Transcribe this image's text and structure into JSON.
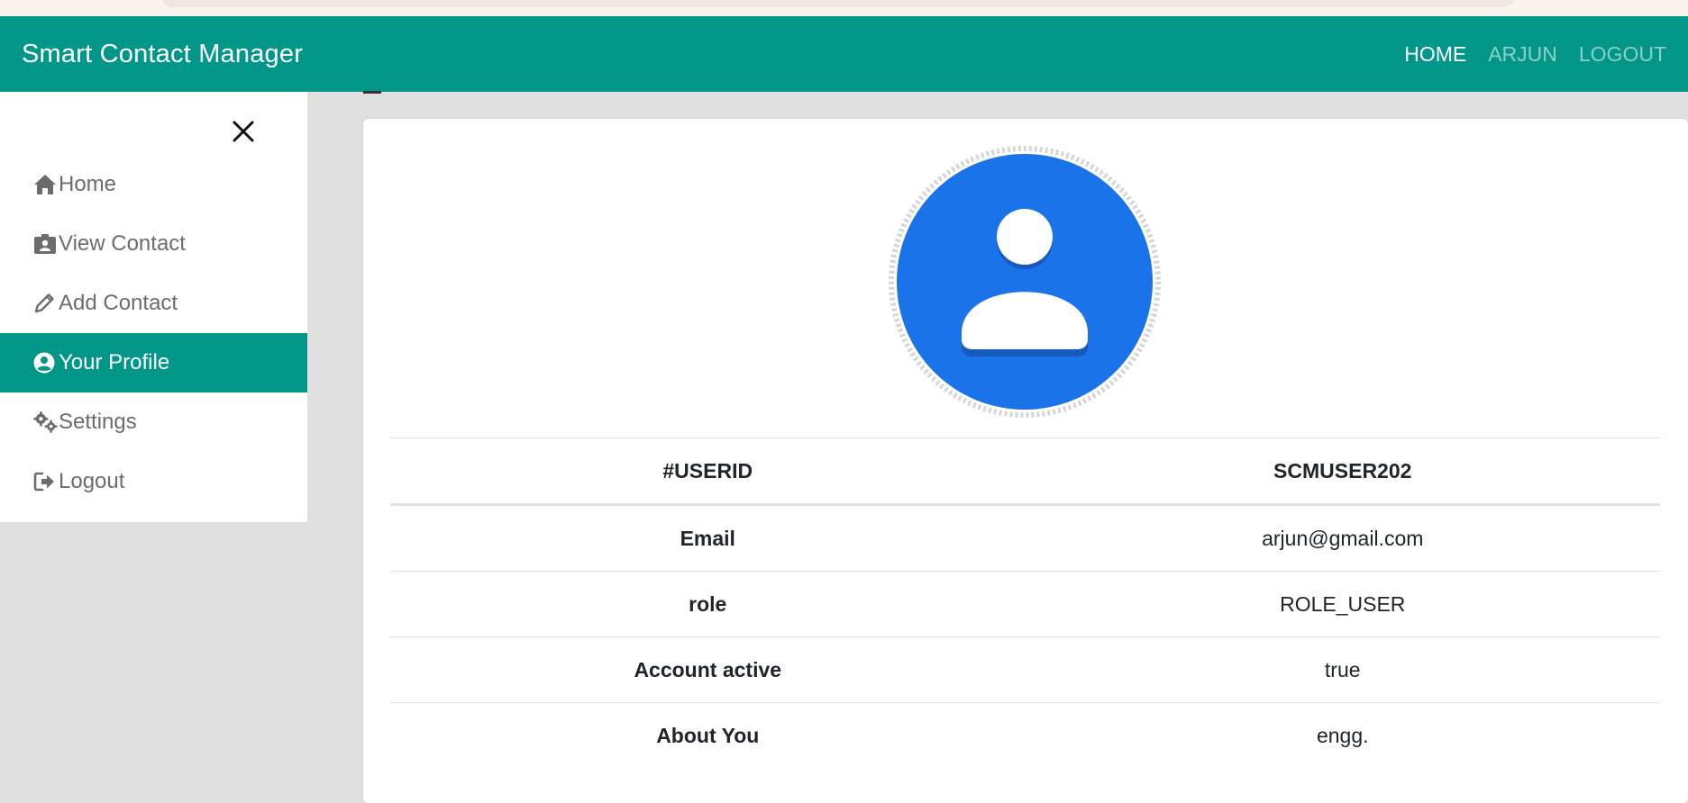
{
  "app": {
    "brand": "Smart Contact Manager"
  },
  "navbar": {
    "links": [
      {
        "label": "HOME"
      },
      {
        "label": "ARJUN"
      },
      {
        "label": "LOGOUT"
      }
    ]
  },
  "sidebar": {
    "items": [
      {
        "label": "Home",
        "icon": "home-icon"
      },
      {
        "label": "View Contact",
        "icon": "id-badge-icon"
      },
      {
        "label": "Add Contact",
        "icon": "pencil-icon"
      },
      {
        "label": "Your Profile",
        "icon": "user-circle-icon",
        "active": true
      },
      {
        "label": "Settings",
        "icon": "gears-icon"
      },
      {
        "label": "Logout",
        "icon": "logout-icon"
      }
    ]
  },
  "profile": {
    "header": {
      "key": "#USERID",
      "value": "SCMUSER202"
    },
    "rows": [
      {
        "key": "Email",
        "value": "arjun@gmail.com"
      },
      {
        "key": "role",
        "value": "ROLE_USER"
      },
      {
        "key": "Account active",
        "value": "true"
      },
      {
        "key": "About You",
        "value": "engg."
      }
    ]
  },
  "colors": {
    "primary": "#009688",
    "avatar": "#1a73e8",
    "background": "#e0e0e0"
  }
}
